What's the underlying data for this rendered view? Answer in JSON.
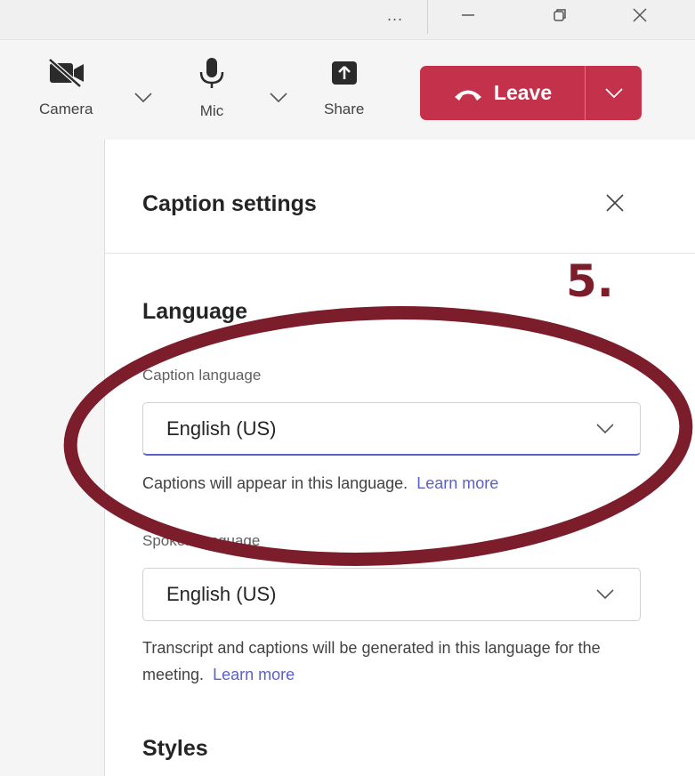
{
  "window": {
    "more_label": "...",
    "controls": [
      "minimize-icon",
      "restore-icon",
      "close-icon"
    ]
  },
  "toolbar": {
    "camera_label": "Camera",
    "mic_label": "Mic",
    "share_label": "Share",
    "leave_label": "Leave"
  },
  "panel": {
    "title": "Caption settings",
    "language_heading": "Language",
    "caption_language_label": "Caption language",
    "caption_language_value": "English (US)",
    "caption_helper": "Captions will appear in this language.",
    "caption_link": "Learn more",
    "spoken_language_label": "Spoken language",
    "spoken_language_value": "English (US)",
    "spoken_helper": "Transcript and captions will be generated in this language for the meeting.",
    "spoken_link": "Learn more",
    "styles_heading": "Styles"
  },
  "annotation": {
    "step": "5.",
    "color": "#7c1d2b"
  },
  "colors": {
    "leave_red": "#c4314b",
    "accent": "#5b5fc7"
  }
}
